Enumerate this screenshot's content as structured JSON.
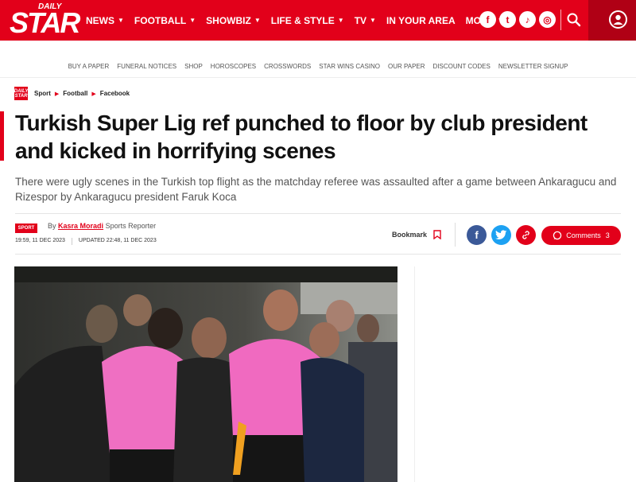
{
  "brand": {
    "logo_top": "DAILY",
    "logo_main": "STAR",
    "color": "#e2001a"
  },
  "nav": {
    "items": [
      {
        "label": "NEWS",
        "has_caret": true
      },
      {
        "label": "FOOTBALL",
        "has_caret": true
      },
      {
        "label": "SHOWBIZ",
        "has_caret": true
      },
      {
        "label": "LIFE & STYLE",
        "has_caret": true
      },
      {
        "label": "TV",
        "has_caret": true
      },
      {
        "label": "IN YOUR AREA",
        "has_caret": false
      },
      {
        "label": "MORE",
        "has_caret": true
      }
    ],
    "social_icons": [
      "facebook-icon",
      "twitter-icon",
      "tiktok-icon",
      "instagram-icon"
    ],
    "social_glyphs": [
      "f",
      "t",
      "♪",
      "◎"
    ]
  },
  "subnav": {
    "items": [
      "BUY A PAPER",
      "FUNERAL NOTICES",
      "SHOP",
      "HOROSCOPES",
      "CROSSWORDS",
      "STAR WINS CASINO",
      "OUR PAPER",
      "DISCOUNT CODES",
      "NEWSLETTER SIGNUP"
    ]
  },
  "breadcrumb": {
    "logo_text": "DAILY STAR",
    "items": [
      "Sport",
      "Football",
      "Facebook"
    ]
  },
  "article": {
    "headline": "Turkish Super Lig ref punched to floor by club president and kicked in horrifying scenes",
    "standfirst": "There were ugly scenes in the Turkish top flight as the matchday referee was assaulted after a game between Ankaragucu and Rizespor by Ankaragucu president Faruk Koca",
    "badge": "SPORT",
    "by": "By",
    "author": "Kasra Moradi",
    "role": "Sports Reporter",
    "published": "19:59, 11 DEC 2023",
    "updated": "UPDATED 22:48, 11 DEC 2023"
  },
  "actions": {
    "bookmark_label": "Bookmark",
    "comments_label": "Comments",
    "comments_count": "3",
    "share_colors": {
      "facebook": "#3b5998",
      "twitter": "#1da1f2",
      "link": "#e2001a"
    }
  }
}
